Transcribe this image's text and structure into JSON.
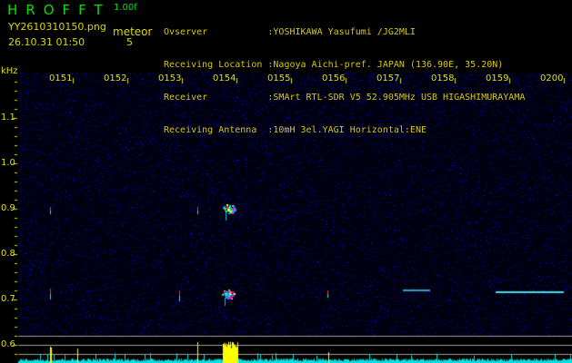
{
  "header": {
    "logo": "HROFFT",
    "version": "1.00f",
    "filename": "YY2610310150.png",
    "datetime": "26.10.31 01:50",
    "meteor_label": "meteor",
    "meteor_count": "5"
  },
  "info": [
    {
      "label": "Ovserver           ",
      "value": ":YOSHIKAWA Yasufumi /JG2MLI"
    },
    {
      "label": "Receiving Location ",
      "value": ":Nagoya Aichi-pref. JAPAN (136.90E, 35.20N)"
    },
    {
      "label": "Receiver           ",
      "value": ":SMArt RTL-SDR V5 52.905MHz USB HIGASHIMURAYAMA"
    },
    {
      "label": "Receiving Antenna  ",
      "value": ":10mH 3el.YAGI Horizontal:ENE"
    }
  ],
  "axis": {
    "unit": "kHz",
    "y_labels": [
      "1.1",
      "1.0",
      "0.9",
      "0.8",
      "0.7",
      "0.6"
    ],
    "time_labels": [
      "0151",
      "0152",
      "0153",
      "0154",
      "0155",
      "0156",
      "0157",
      "0158",
      "0159",
      "0200"
    ]
  },
  "colors": {
    "background": "#000000",
    "text": "#e0e000",
    "logo": "#00e000",
    "noise": "#1a1aa0",
    "histogram": "#ffff00",
    "baseline": "#00e0e0"
  }
}
